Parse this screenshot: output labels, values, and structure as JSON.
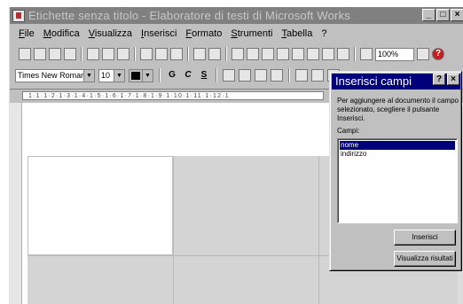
{
  "window": {
    "title": "Etichette senza titolo - Elaboratore di testi di Microsoft Works",
    "controls": [
      "_",
      "□",
      "×"
    ]
  },
  "menubar": {
    "items": [
      "File",
      "Modifica",
      "Visualizza",
      "Inserisci",
      "Formato",
      "Strumenti",
      "Tabella",
      "?"
    ]
  },
  "toolbar": {
    "zoom": "100%",
    "help_icon": "?"
  },
  "format_bar": {
    "font": "Times New Roman",
    "size": "10",
    "bold": "G",
    "italic": "C",
    "underline": "S"
  },
  "ruler": {
    "marks": "1·1·1·2·1·3·1·4·1·5·1·6·1·7·1·8·1·9·1·10·1·11·1·12·1"
  },
  "dialog": {
    "title": "Inserisci campi",
    "help": "?",
    "close": "×",
    "instructions": "Per aggiungere al documento il campo selezionato, scegliere il pulsante Inserisci.",
    "fields_label": "Campi:",
    "fields": [
      "nome",
      "indirizzo"
    ],
    "selected_field": "nome",
    "insert_button": "Inserisci",
    "view_results_button": "Visualizza risultati"
  }
}
